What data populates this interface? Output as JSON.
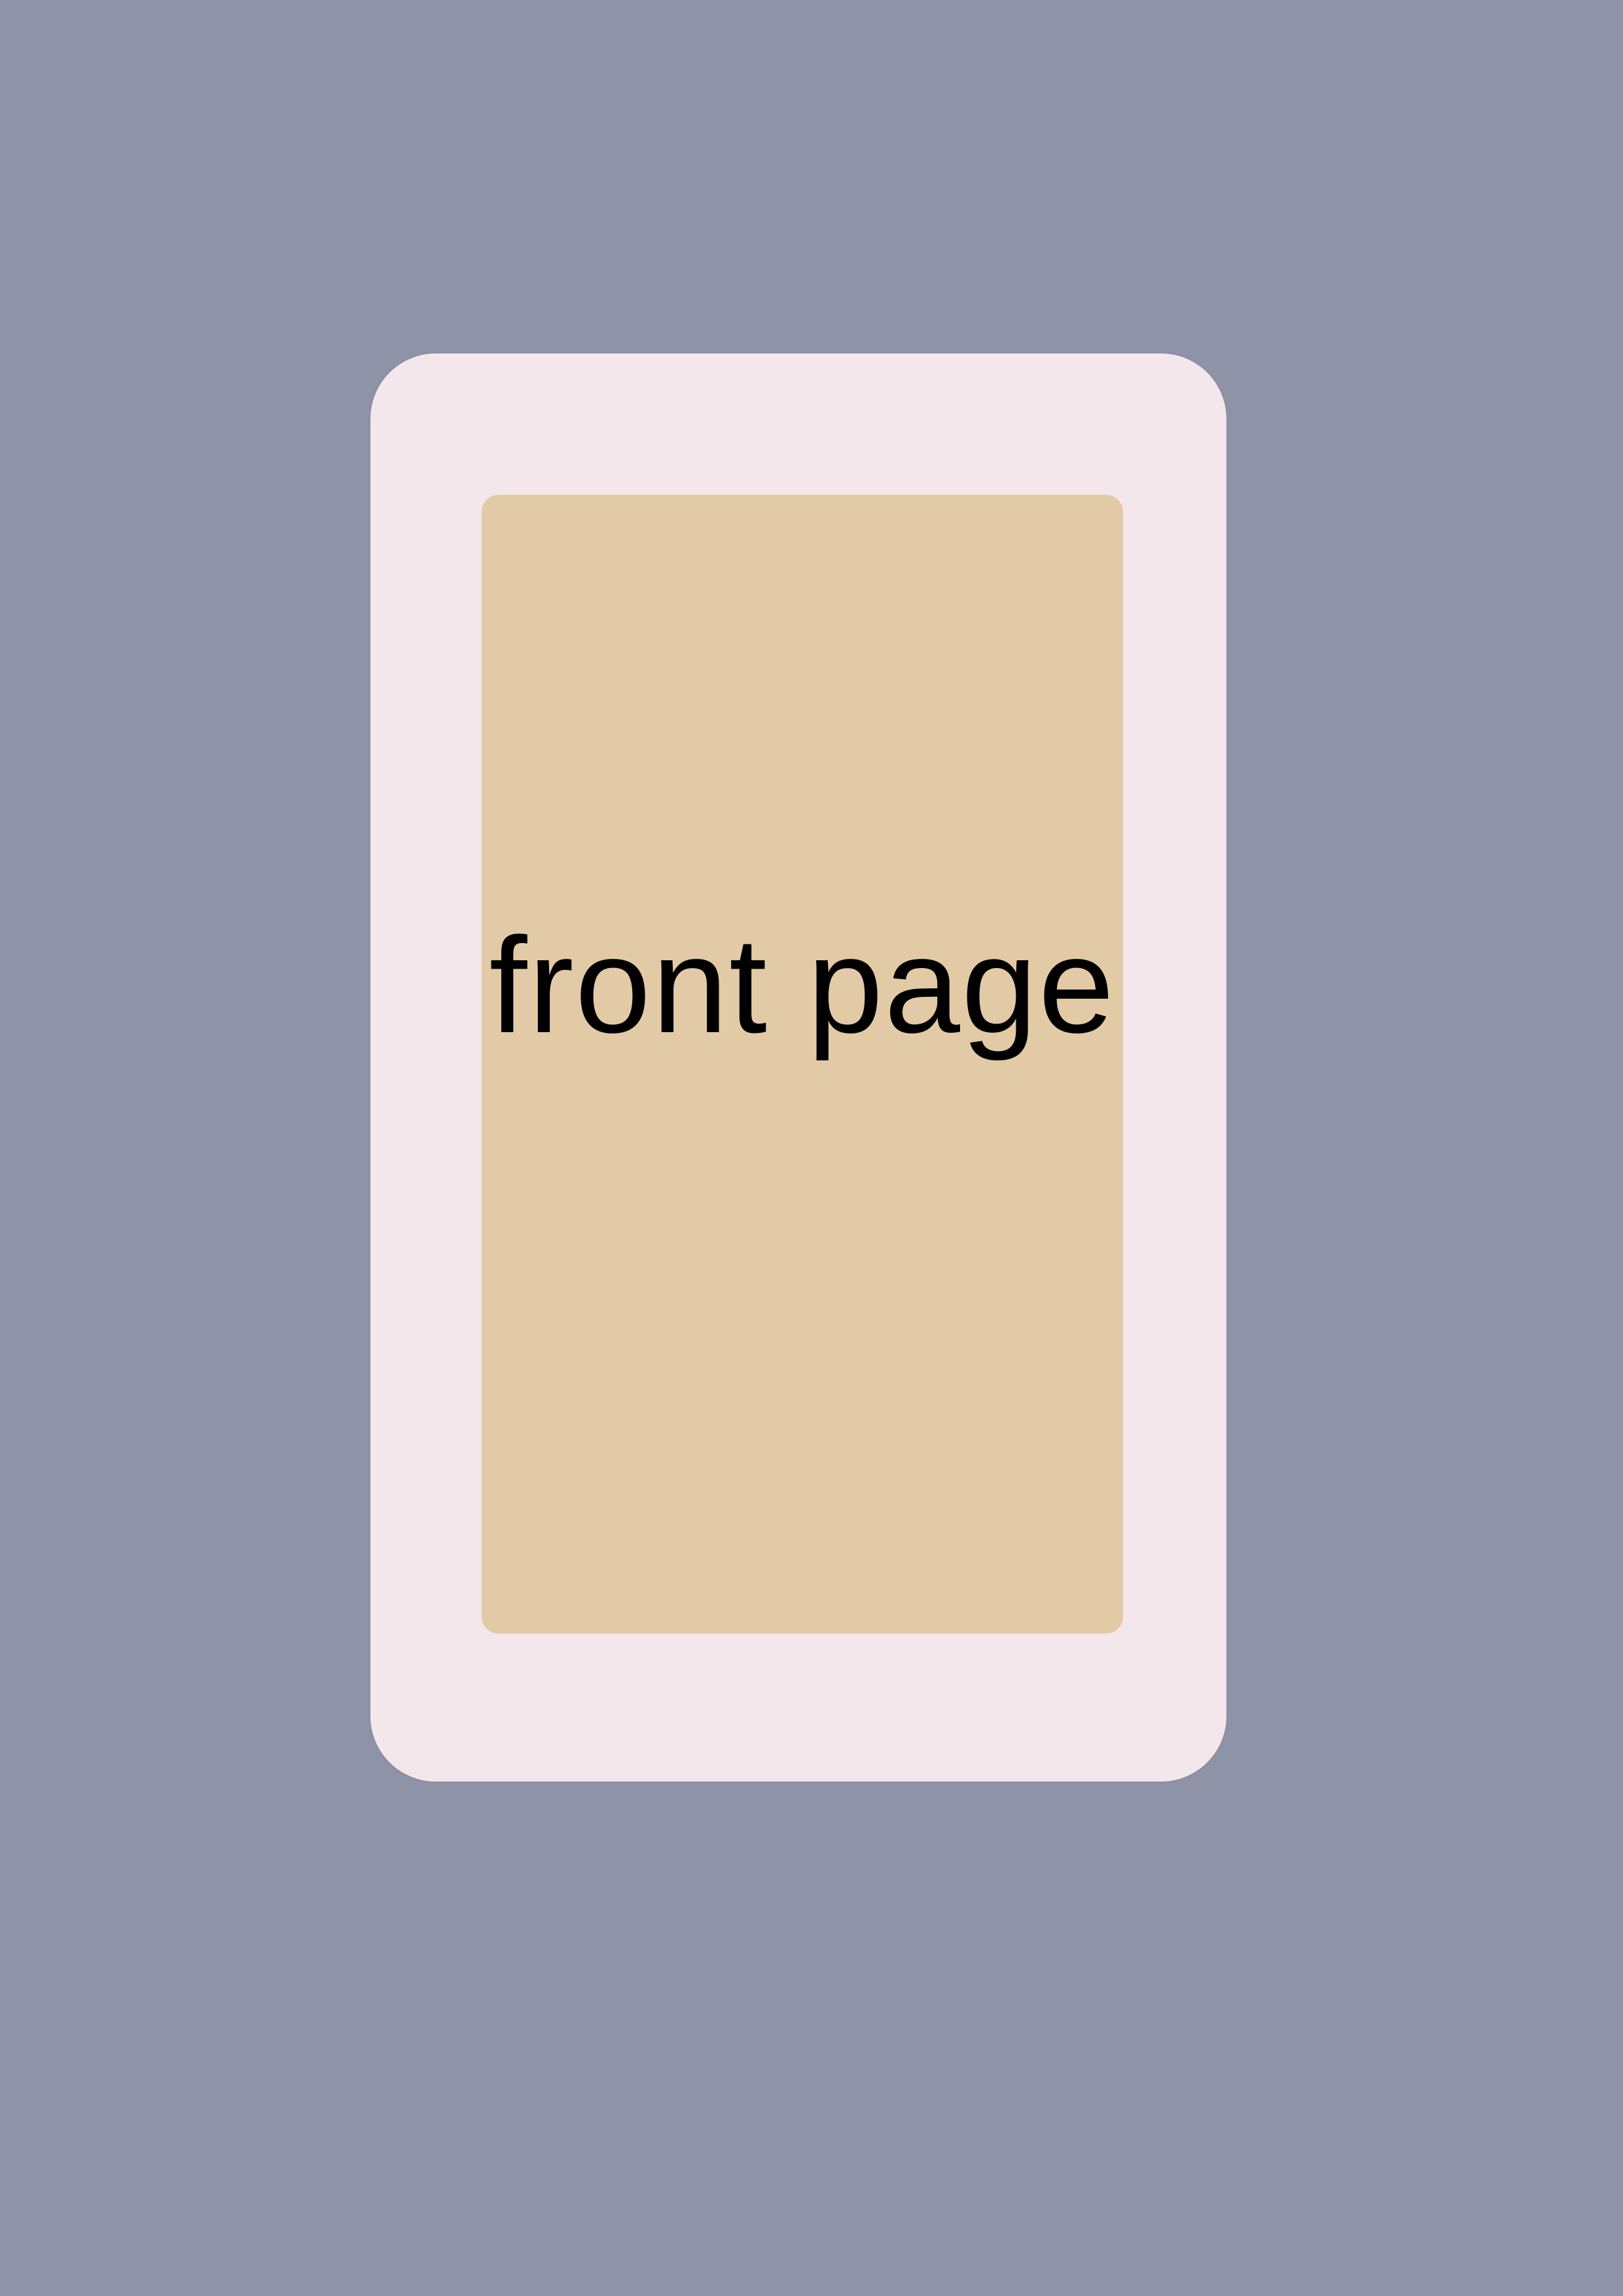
{
  "background_color": "#8f93a8",
  "frame_color": "#f3e7ec",
  "panel_color": "#e3caa6",
  "panel": {
    "label": "front page"
  }
}
